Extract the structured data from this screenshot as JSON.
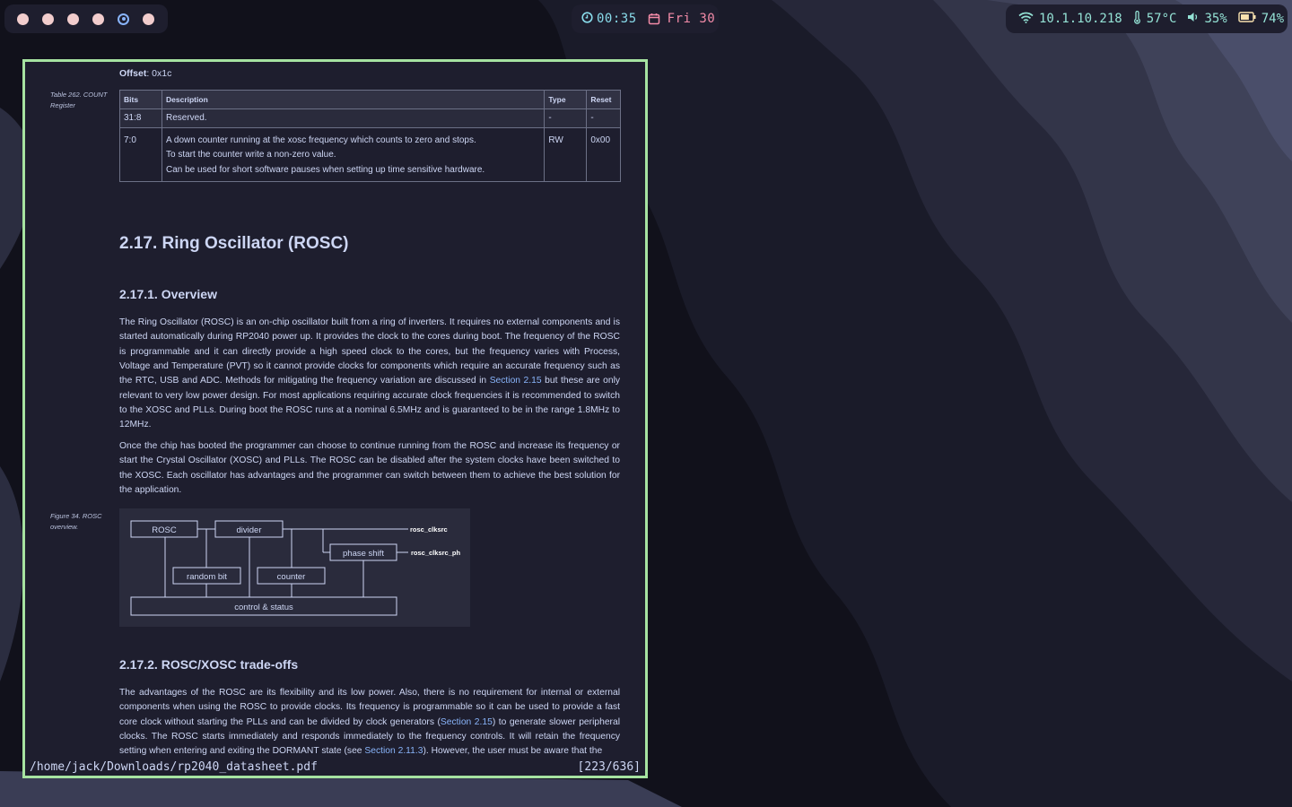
{
  "colors": {
    "bar_bg": "#1e1e2e",
    "workspace_dot": "#f2cdcd",
    "workspace_active": "#89b4fa",
    "clock_time": "#89dceb",
    "clock_date": "#f38ba8",
    "status_text": "#94e2d5",
    "viewer_border": "#a6e3a1",
    "link": "#89b4fa"
  },
  "workspaces": [
    {
      "icon": "circle-icon",
      "active": false
    },
    {
      "icon": "circle-icon",
      "active": false
    },
    {
      "icon": "circle-icon",
      "active": false
    },
    {
      "icon": "circle-icon",
      "active": false
    },
    {
      "icon": "target-circle-icon",
      "active": true
    },
    {
      "icon": "circle-icon",
      "active": false
    }
  ],
  "clock": {
    "time": "00:35",
    "date": "Fri 30"
  },
  "status": {
    "ip": "10.1.10.218",
    "temperature": "57°C",
    "volume": "35%",
    "battery": "74%",
    "battery_level": 0.74
  },
  "document": {
    "offset_label": "Offset",
    "offset_value": ": 0x1c",
    "table_caption": "Table 262. COUNT Register",
    "table": {
      "headers": [
        "Bits",
        "Description",
        "Type",
        "Reset"
      ],
      "rows": [
        {
          "bits": "31:8",
          "desc": [
            "Reserved."
          ],
          "type": "-",
          "reset": "-"
        },
        {
          "bits": "7:0",
          "desc": [
            "A down counter running at the xosc frequency which counts to zero and stops.",
            "To start the counter write a non-zero value.",
            "Can be used for short software pauses when setting up time sensitive hardware."
          ],
          "type": "RW",
          "reset": "0x00"
        }
      ]
    },
    "section_title": "2.17. Ring Oscillator (ROSC)",
    "overview_title": "2.17.1. Overview",
    "para1_a": "The Ring Oscillator (ROSC) is an on-chip oscillator built from a ring of inverters. It requires no external components and is started automatically during RP2040 power up. It provides the clock to the cores during boot. The frequency of the ROSC is programmable and it can directly provide a high speed clock to the cores, but the frequency varies with Process, Voltage and Temperature (PVT) so it cannot provide clocks for components which require an accurate frequency such as the RTC, USB and ADC. Methods for mitigating the frequency variation are discussed in ",
    "para1_link": "Section 2.15",
    "para1_b": " but these are only relevant to very low power design. For most applications requiring accurate clock frequencies it is recommended to switch to the XOSC and PLLs. During boot the ROSC runs at a nominal 6.5MHz and is guaranteed to be in the range 1.8MHz to 12MHz.",
    "para2": "Once the chip has booted the programmer can choose to continue running from the ROSC and increase its frequency or start the Crystal Oscillator (XOSC) and PLLs. The ROSC can be disabled after the system clocks have been switched to the XOSC. Each oscillator has advantages and the programmer can switch between them to achieve the best solution for the application.",
    "figure_caption": "Figure 34. ROSC overview.",
    "diagram": {
      "rosc": "ROSC",
      "divider": "divider",
      "phase_shift": "phase shift",
      "random_bit": "random bit",
      "counter": "counter",
      "control_status": "control & status",
      "out1": "rosc_clksrc",
      "out2": "rosc_clksrc_ph"
    },
    "tradeoffs_title": "2.17.2. ROSC/XOSC trade-offs",
    "para3_a": "The advantages of the ROSC are its flexibility and its low power. Also, there is no requirement for internal or external components when using the ROSC to provide clocks. Its frequency is programmable so it can be used to provide a fast core clock without starting the PLLs and can be divided by clock generators (",
    "para3_link1": "Section 2.15",
    "para3_b": ") to generate slower peripheral clocks. The ROSC starts immediately and responds immediately to the frequency controls. It will retain the frequency setting when entering and exiting the DORMANT state (see ",
    "para3_link2": "Section 2.11.3",
    "para3_c": "). However, the user must be aware that the"
  },
  "viewer": {
    "file_path": "/home/jack/Downloads/rp2040_datasheet.pdf",
    "page_indicator": "[223/636]"
  }
}
